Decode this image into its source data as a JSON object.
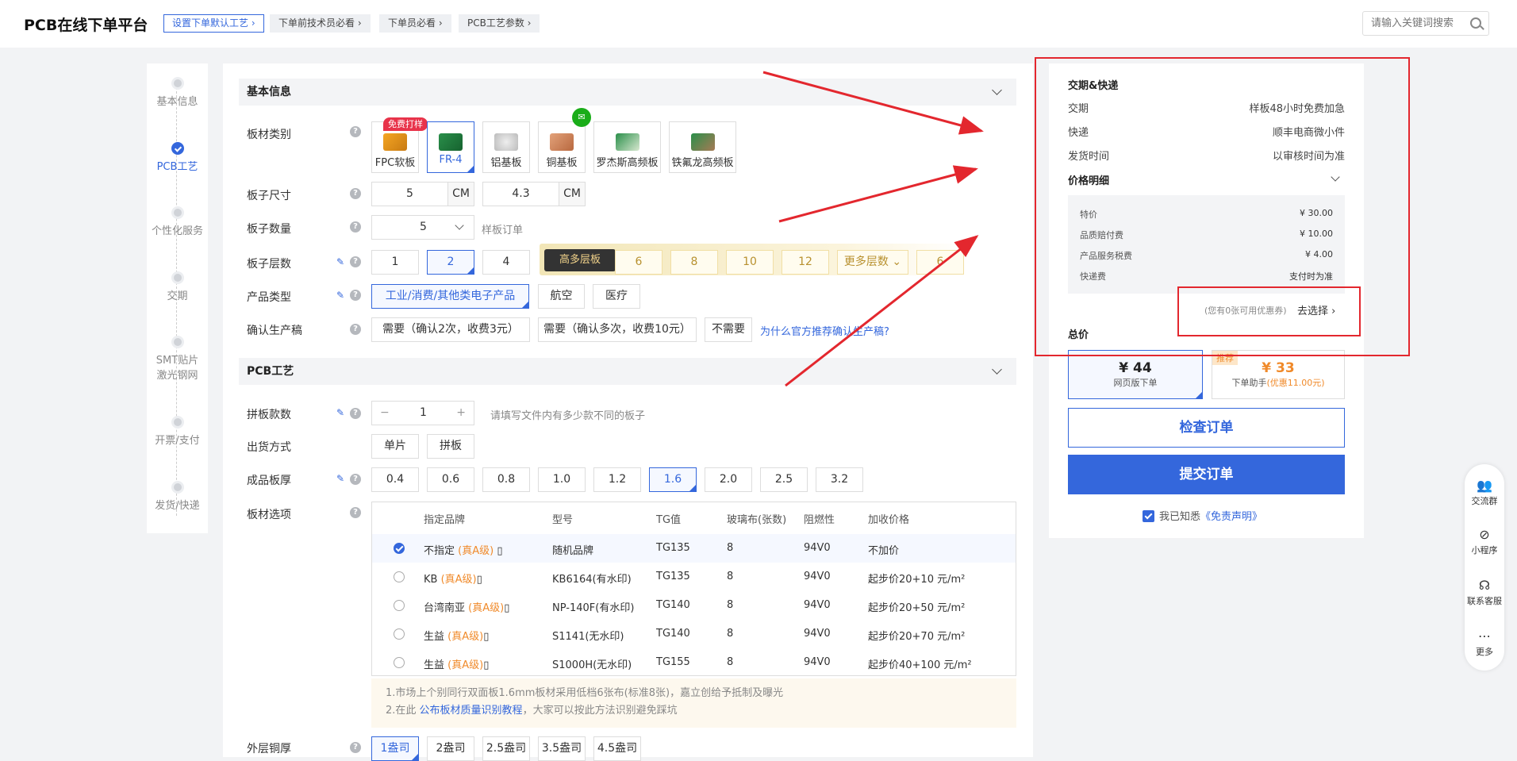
{
  "header": {
    "logo": "PCB在线下单平台",
    "crumbs": [
      "设置下单默认工艺 ›",
      "下单前技术员必看 ›",
      "下单员必看 ›",
      "PCB工艺参数 ›"
    ],
    "search_placeholder": "请输入关键词搜索"
  },
  "steps": [
    "基本信息",
    "PCB工艺",
    "个性化服务",
    "交期",
    "SMT贴片",
    "激光钢网",
    "开票/支付",
    "发货/快递"
  ],
  "basic": {
    "section_title": "基本信息",
    "material_label": "板材类别",
    "free_badge": "免费打样",
    "materials": [
      "FPC软板",
      "FR-4",
      "铝基板",
      "铜基板",
      "罗杰斯高频板",
      "铁氟龙高频板"
    ],
    "size_label": "板子尺寸",
    "size_w": "5",
    "size_h": "4.3",
    "unit": "CM",
    "qty_label": "板子数量",
    "qty_value": "5",
    "qty_hint": "样板订单",
    "layers_label": "板子层数",
    "layers": [
      "1",
      "2",
      "4"
    ],
    "multi_tag": "高多层板",
    "multi_layers": [
      "6",
      "8",
      "10",
      "12"
    ],
    "more_layers": "更多层数",
    "extra_layer": "6",
    "product_label": "产品类型",
    "products": [
      "工业/消费/其他类电子产品",
      "航空",
      "医疗"
    ],
    "confirm_label": "确认生产稿",
    "confirms": [
      "需要（确认2次，收费3元）",
      "需要（确认多次，收费10元）",
      "不需要"
    ],
    "confirm_link": "为什么官方推荐确认生产稿?"
  },
  "pcb": {
    "section_title": "PCB工艺",
    "panel_label": "拼板款数",
    "panel_minus": "−",
    "panel_value": "1",
    "panel_plus": "+",
    "panel_hint": "请填写文件内有多少款不同的板子",
    "ship_label": "出货方式",
    "ship_opts": [
      "单片",
      "拼板"
    ],
    "thick_label": "成品板厚",
    "thick_opts": [
      "0.4",
      "0.6",
      "0.8",
      "1.0",
      "1.2",
      "1.6",
      "2.0",
      "2.5",
      "3.2"
    ],
    "board_label": "板材选项",
    "table_headers": [
      "指定品牌",
      "型号",
      "TG值",
      "玻璃布(张数)",
      "阻燃性",
      "加收价格"
    ],
    "grade": "(真A级)",
    "rows": [
      {
        "brand": "不指定",
        "model": "随机品牌",
        "tg": "TG135",
        "cloth": "8",
        "fr": "94V0",
        "price": "不加价"
      },
      {
        "brand": "KB",
        "model": "KB6164(有水印)",
        "tg": "TG135",
        "cloth": "8",
        "fr": "94V0",
        "price": "起步价20+10 元/m²"
      },
      {
        "brand": "台湾南亚",
        "model": "NP-140F(有水印)",
        "tg": "TG140",
        "cloth": "8",
        "fr": "94V0",
        "price": "起步价20+50 元/m²"
      },
      {
        "brand": "生益",
        "model": "S1141(无水印)",
        "tg": "TG140",
        "cloth": "8",
        "fr": "94V0",
        "price": "起步价20+70 元/m²"
      },
      {
        "brand": "生益",
        "model": "S1000H(无水印)",
        "tg": "TG155",
        "cloth": "8",
        "fr": "94V0",
        "price": "起步价40+100 元/m²"
      }
    ],
    "note1": "1.市场上个别同行双面板1.6mm板材采用低档6张布(标准8张)，嘉立创给予抵制及曝光",
    "note2_pre": "2.在此",
    "note2_link": "公布板材质量识别教程",
    "note2_post": "，大家可以按此方法识别避免踩坑",
    "copper_label": "外层铜厚",
    "copper_opts": [
      "1盎司",
      "2盎司",
      "2.5盎司",
      "3.5盎司",
      "4.5盎司"
    ]
  },
  "right": {
    "delivery_title": "交期&快递",
    "rows": [
      {
        "k": "交期",
        "v": "样板48小时免费加急"
      },
      {
        "k": "快递",
        "v": "顺丰电商微小件"
      },
      {
        "k": "发货时间",
        "v": "以审核时间为准"
      }
    ],
    "price_title": "价格明细",
    "price_rows": [
      {
        "k": "特价",
        "v": "¥ 30.00"
      },
      {
        "k": "品质赔付费",
        "v": "¥ 10.00"
      },
      {
        "k": "产品服务税费",
        "v": "¥ 4.00"
      },
      {
        "k": "快递费",
        "v": "支付时为准"
      }
    ],
    "coupon_hint": "(您有0张可用优惠券)",
    "coupon_action": "去选择 ›",
    "total_title": "总价",
    "web_price": "¥ 44",
    "web_label": "网页版下单",
    "rec_tag": "推荐",
    "helper_price": "¥ 33",
    "helper_label": "下单助手",
    "helper_discount": "(优惠11.00元)",
    "check_btn": "检查订单",
    "submit_btn": "提交订单",
    "agree_pre": "我已知悉",
    "agree_link": "《免责声明》"
  },
  "float": [
    "交流群",
    "小程序",
    "联系客服",
    "更多"
  ],
  "colors": {
    "accent": "#3467dc",
    "annotation": "#e3272e",
    "price": "#f08a2a"
  }
}
